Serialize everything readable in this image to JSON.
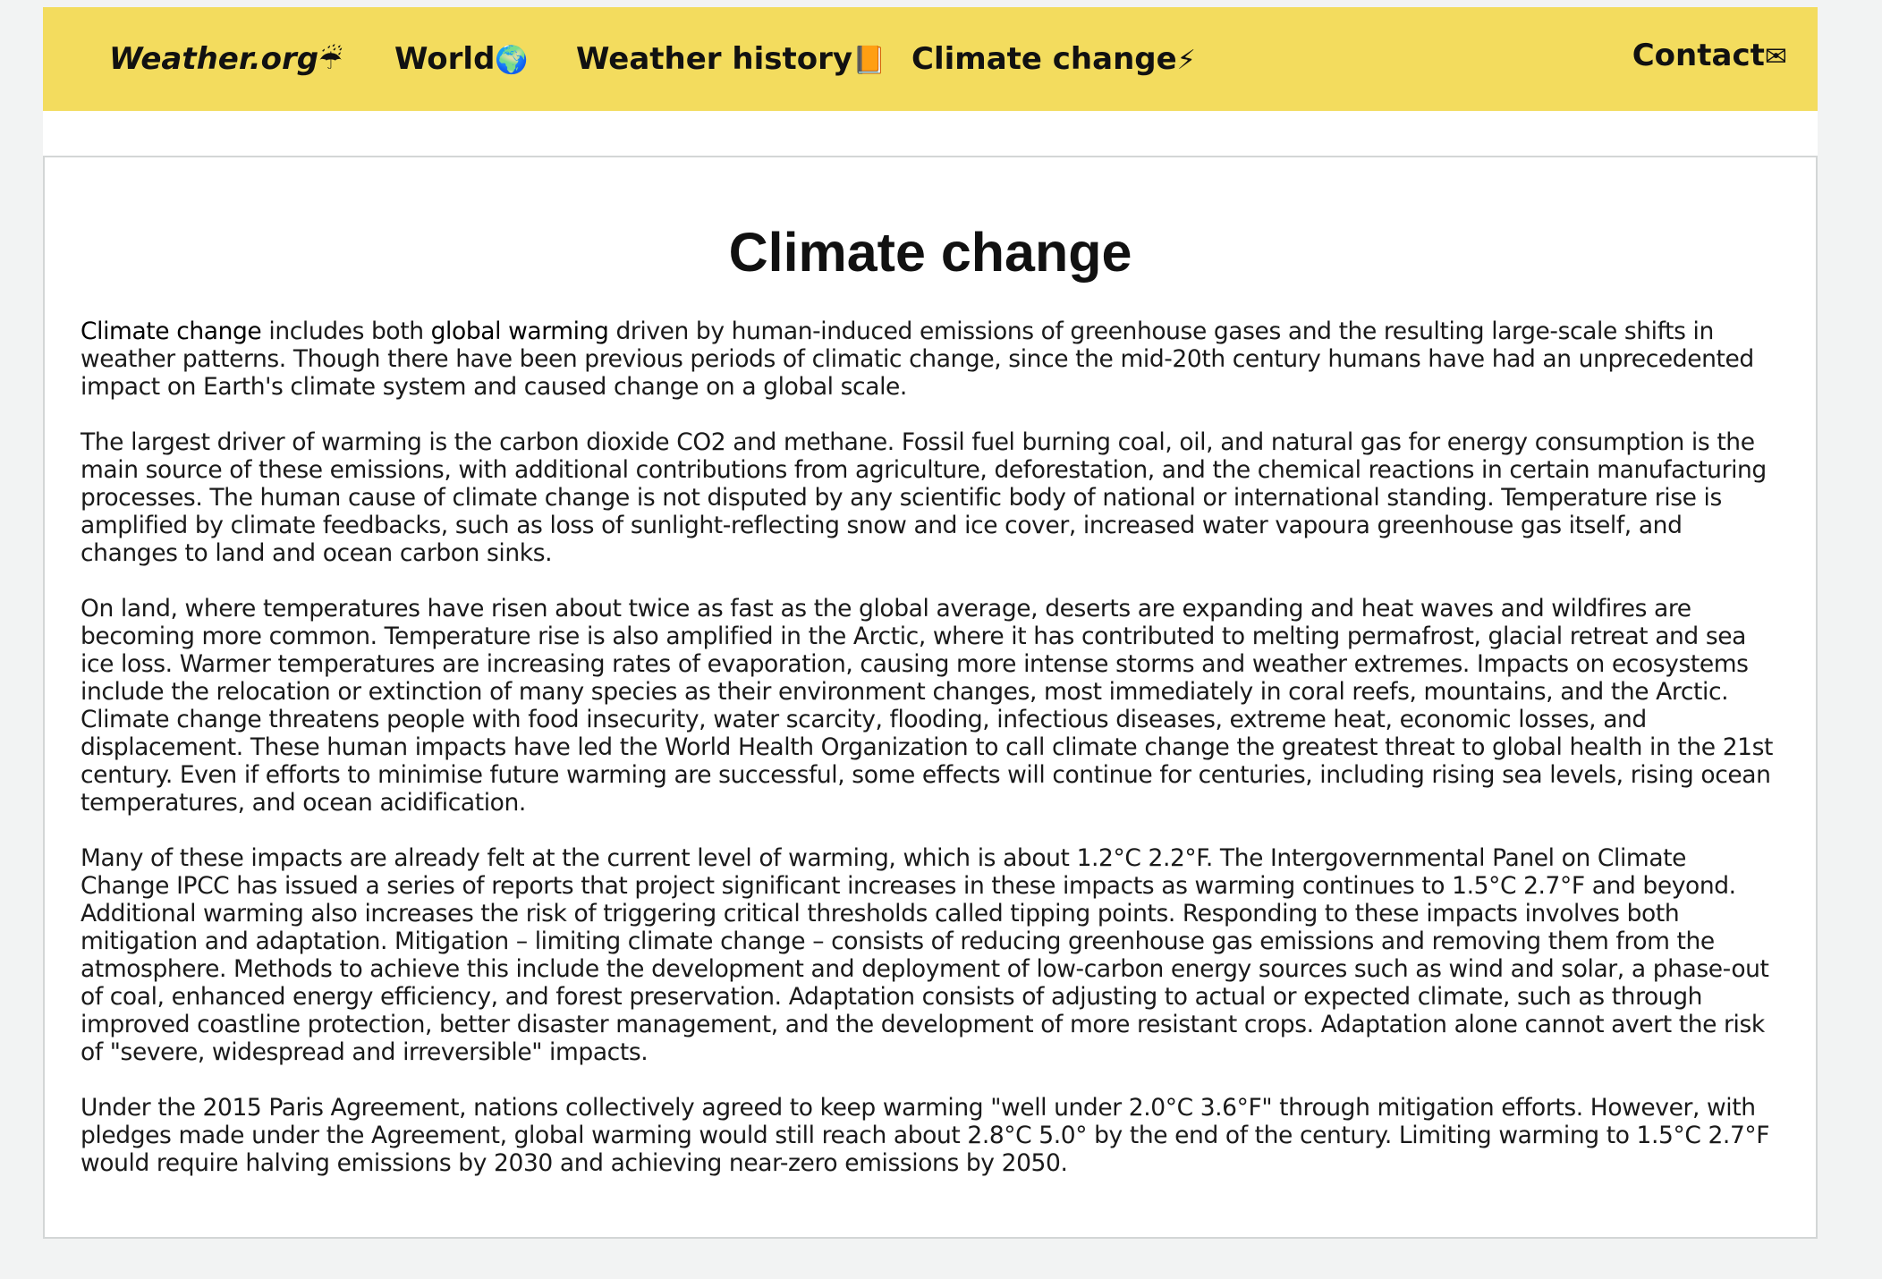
{
  "nav": {
    "brand": "Weather.org",
    "brand_icon": "☔",
    "world": "World",
    "world_icon": "🌍",
    "history": "Weather history",
    "history_icon": "📙",
    "climate": "Climate change",
    "climate_icon": "⚡",
    "contact": "Contact",
    "contact_icon": "✉"
  },
  "article": {
    "title": "Climate change",
    "p1_term1": "Climate change",
    "p1_text1": " includes both ",
    "p1_term2": "global warming",
    "p1_text2": " driven by human-induced emissions of greenhouse gases and the resulting large-scale shifts in weather patterns. Though there have been previous periods of climatic change, since the mid-20th century humans have had an unprecedented impact on Earth's climate system and caused change on a global scale.",
    "p2": "The largest driver of warming is the carbon dioxide CO2 and methane. Fossil fuel burning coal, oil, and natural gas for energy consumption is the main source of these emissions, with additional contributions from agriculture, deforestation, and the chemical reactions in certain manufacturing processes. The human cause of climate change is not disputed by any scientific body of national or international standing. Temperature rise is amplified by climate feedbacks, such as loss of sunlight-reflecting snow and ice cover, increased water vapoura greenhouse gas itself, and changes to land and ocean carbon sinks.",
    "p3": "On land, where temperatures have risen about twice as fast as the global average, deserts are expanding and heat waves and wildfires are becoming more common. Temperature rise is also amplified in the Arctic, where it has contributed to melting permafrost, glacial retreat and sea ice loss. Warmer temperatures are increasing rates of evaporation, causing more intense storms and weather extremes. Impacts on ecosystems include the relocation or extinction of many species as their environment changes, most immediately in coral reefs, mountains, and the Arctic. Climate change threatens people with food insecurity, water scarcity, flooding, infectious diseases, extreme heat, economic losses, and displacement. These human impacts have led the World Health Organization to call climate change the greatest threat to global health in the 21st century. Even if efforts to minimise future warming are successful, some effects will continue for centuries, including rising sea levels, rising ocean temperatures, and ocean acidification.",
    "p4": "Many of these impacts are already felt at the current level of warming, which is about 1.2°C 2.2°F. The Intergovernmental Panel on Climate Change IPCC has issued a series of reports that project significant increases in these impacts as warming continues to 1.5°C 2.7°F and beyond. Additional warming also increases the risk of triggering critical thresholds called tipping points. Responding to these impacts involves both mitigation and adaptation. Mitigation – limiting climate change – consists of reducing greenhouse gas emissions and removing them from the atmosphere. Methods to achieve this include the development and deployment of low-carbon energy sources such as wind and solar, a phase-out of coal, enhanced energy efficiency, and forest preservation. Adaptation consists of adjusting to actual or expected climate, such as through improved coastline protection, better disaster management, and the development of more resistant crops. Adaptation alone cannot avert the risk of \"severe, widespread and irreversible\" impacts.",
    "p5": "Under the 2015 Paris Agreement, nations collectively agreed to keep warming \"well under 2.0°C 3.6°F\" through mitigation efforts. However, with pledges made under the Agreement, global warming would still reach about 2.8°C 5.0° by the end of the century. Limiting warming to 1.5°C 2.7°F would require halving emissions by 2030 and achieving near-zero emissions by 2050."
  }
}
